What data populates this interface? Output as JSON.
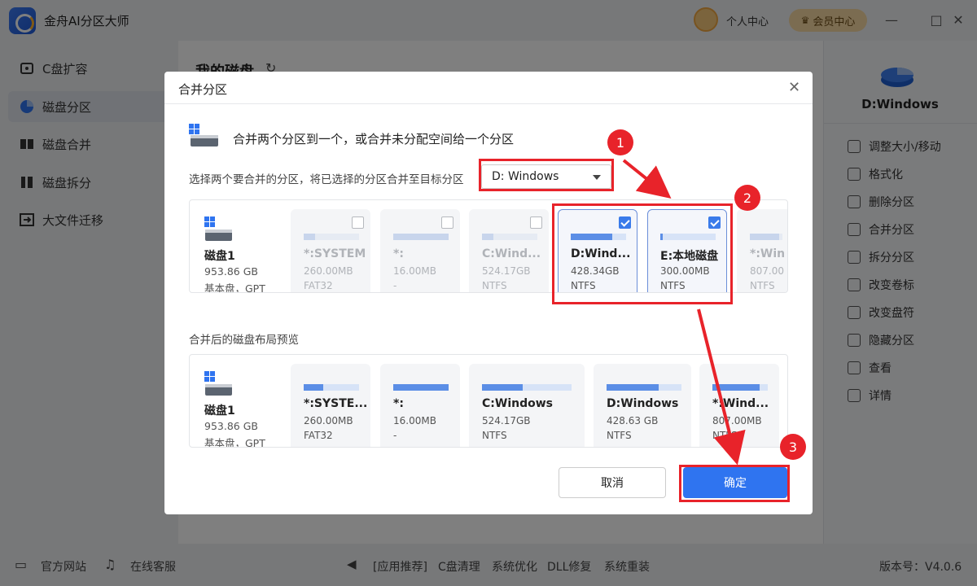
{
  "app": {
    "title": "金舟AI分区大师",
    "user_center": "个人中心",
    "member_center": "会员中心"
  },
  "window": {
    "minimize": "—",
    "maximize": "□",
    "close": "✕"
  },
  "sidebar": {
    "items": [
      {
        "label": "C盘扩容",
        "icon": "disk-expand-icon"
      },
      {
        "label": "磁盘分区",
        "icon": "pie-partition-icon",
        "active": true
      },
      {
        "label": "磁盘合并",
        "icon": "merge-icon"
      },
      {
        "label": "磁盘拆分",
        "icon": "split-icon"
      },
      {
        "label": "大文件迁移",
        "icon": "migrate-icon"
      }
    ]
  },
  "main": {
    "title": "我的磁盘",
    "refresh": "↻"
  },
  "right_panel": {
    "disk_name": "D:Windows",
    "actions": [
      {
        "label": "调整大小/移动",
        "icon": "resize-icon"
      },
      {
        "label": "格式化",
        "icon": "format-icon"
      },
      {
        "label": "删除分区",
        "icon": "trash-icon"
      },
      {
        "label": "合并分区",
        "icon": "merge-icon"
      },
      {
        "label": "拆分分区",
        "icon": "split-icon"
      },
      {
        "label": "改变卷标",
        "icon": "tag-icon"
      },
      {
        "label": "改变盘符",
        "icon": "letter-icon"
      },
      {
        "label": "隐藏分区",
        "icon": "eye-off-icon"
      },
      {
        "label": "查看",
        "icon": "view-icon"
      },
      {
        "label": "详情",
        "icon": "details-icon"
      }
    ]
  },
  "bottom": {
    "website": "官方网站",
    "support": "在线客服",
    "recommend": "[应用推荐]",
    "links": [
      "C盘清理",
      "系统优化",
      "DLL修复",
      "系统重装"
    ],
    "version": "版本号：V4.0.6"
  },
  "dialog": {
    "title": "合并分区",
    "close": "✕",
    "heading": "合并两个分区到一个，或合并未分配空间给一个分区",
    "select_label": "选择两个要合并的分区，将已选择的分区合并至目标分区",
    "select_value": "D: Windows",
    "disk": {
      "name": "磁盘1",
      "size": "953.86 GB",
      "type": "基本盘，GPT"
    },
    "partitions": [
      {
        "name": "*:SYSTEM",
        "size": "260.00MB",
        "fs": "FAT32",
        "fill": 0.2,
        "checked": false,
        "dim": true
      },
      {
        "name": "*:",
        "size": "16.00MB",
        "fs": "-",
        "fill": 1.0,
        "checked": false,
        "dim": true
      },
      {
        "name": "C:Wind...",
        "size": "524.17GB",
        "fs": "NTFS",
        "fill": 0.2,
        "checked": false,
        "dim": true
      },
      {
        "name": "D:Wind...",
        "size": "428.34GB",
        "fs": "NTFS",
        "fill": 0.75,
        "checked": true,
        "dim": false
      },
      {
        "name": "E:本地磁盘",
        "size": "300.00MB",
        "fs": "NTFS",
        "fill": 0.05,
        "checked": true,
        "dim": false
      },
      {
        "name": "*:Win",
        "size": "807.00",
        "fs": "NTFS",
        "fill": 0.9,
        "checked": false,
        "dim": true
      }
    ],
    "preview_label": "合并后的磁盘布局预览",
    "preview": [
      {
        "name": "*:SYSTE...",
        "size": "260.00MB",
        "fs": "FAT32",
        "fill": 0.35
      },
      {
        "name": "*:",
        "size": "16.00MB",
        "fs": "-",
        "fill": 1.0
      },
      {
        "name": "C:Windows",
        "size": "524.17GB",
        "fs": "NTFS",
        "fill": 0.45
      },
      {
        "name": "D:Windows",
        "size": "428.63 GB",
        "fs": "NTFS",
        "fill": 0.7
      },
      {
        "name": "*:Wind...",
        "size": "807.00MB",
        "fs": "NTFS",
        "fill": 0.85
      }
    ],
    "cancel": "取消",
    "confirm": "确定"
  },
  "annotations": [
    "1",
    "2",
    "3"
  ],
  "colors": {
    "accent": "#2f74f0",
    "annotation": "#e8232a",
    "bar_fill": "#5b8ee6"
  }
}
